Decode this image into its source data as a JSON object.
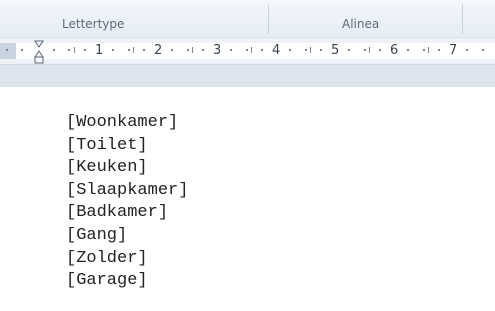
{
  "ribbon": {
    "groups": [
      {
        "label": "Lettertype"
      },
      {
        "label": "Alinea"
      }
    ]
  },
  "ruler": {
    "numbers": [
      "1",
      "2",
      "3",
      "4",
      "5",
      "6",
      "7"
    ]
  },
  "document": {
    "lines": [
      "[Woonkamer]",
      "[Toilet]",
      "[Keuken]",
      "[Slaapkamer]",
      "[Badkamer]",
      "[Gang]",
      "[Zolder]",
      "[Garage]"
    ]
  }
}
